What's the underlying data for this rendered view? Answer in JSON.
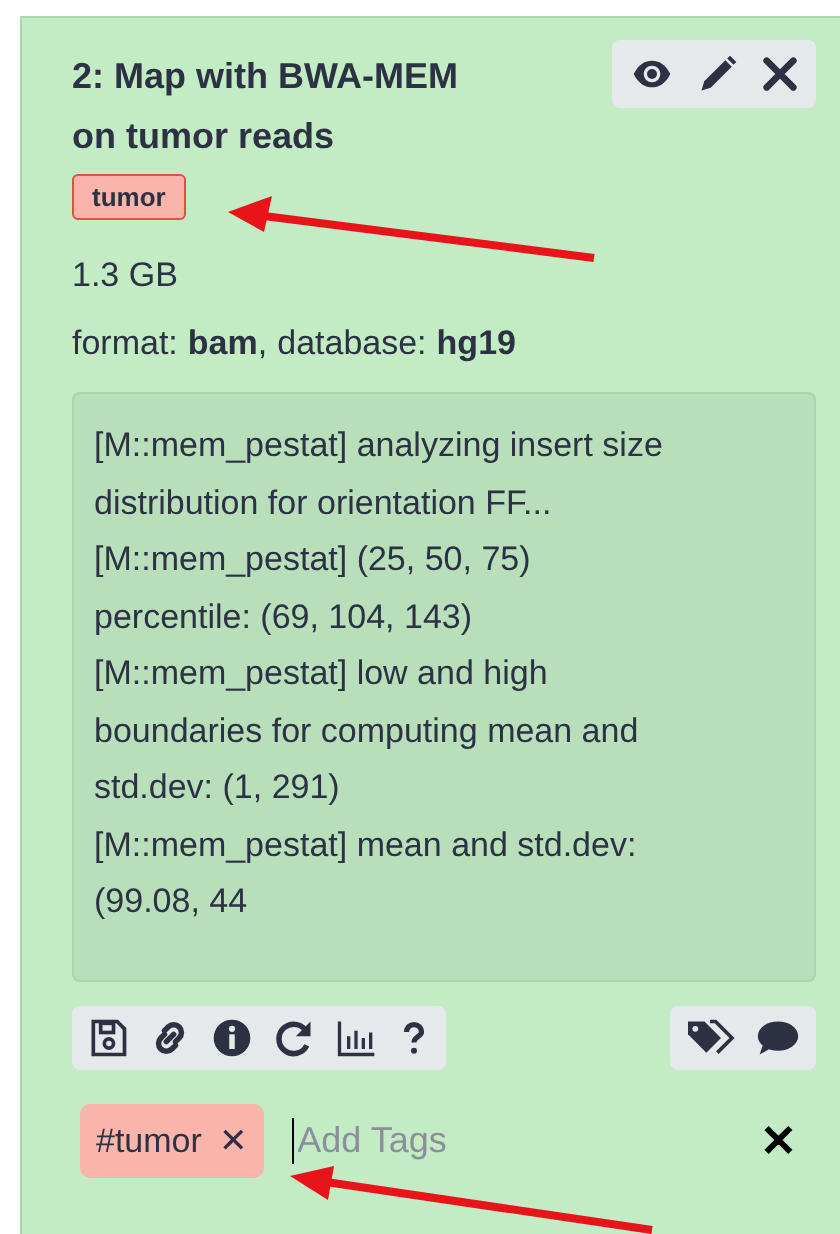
{
  "dataset": {
    "title": "2: Map with BWA-MEM on tumor reads",
    "tags": [
      {
        "label": "tumor",
        "color": "#f9b5ab"
      }
    ],
    "size": "1.3 GB",
    "format_label": "format:",
    "format": "bam",
    "separator": ",",
    "database_label": "database:",
    "database": "hg19",
    "log_lines": [
      "[M::mem_pestat] analyzing insert size",
      "distribution for orientation FF...",
      "[M::mem_pestat] (25, 50, 75)",
      "percentile: (69, 104, 143)",
      "[M::mem_pestat] low and high",
      "boundaries for computing mean and",
      "std.dev: (1, 291)",
      "[M::mem_pestat] mean and std.dev:",
      "(99.08, 44"
    ],
    "tag_editor": {
      "tags": [
        {
          "label": "#tumor",
          "remove": "✕"
        }
      ],
      "placeholder": "Add Tags",
      "close": "✕"
    }
  }
}
